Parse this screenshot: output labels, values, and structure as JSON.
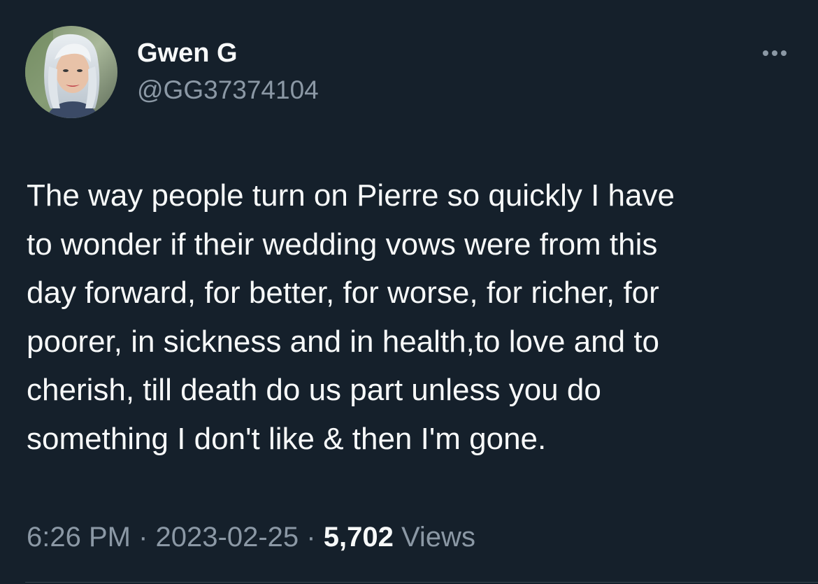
{
  "author": {
    "display_name": "Gwen G",
    "handle": "@GG37374104",
    "avatar_icon": "profile-photo"
  },
  "more_icon": "more-horizontal-icon",
  "tweet": {
    "text": "The way people turn on Pierre so quickly I have\nto wonder if their wedding vows were from this\nday forward, for better, for worse, for richer, for\npoorer, in sickness and in health,to love and to\ncherish, till death do us part unless you do\nsomething I don't like & then I'm gone.",
    "time": "6:26 PM",
    "date": "2023-02-25",
    "views_count": "5,702",
    "views_label": "Views",
    "separator": "·"
  },
  "colors": {
    "background": "#15202b",
    "primary_text": "#f7f9f9",
    "secondary_text": "#8b98a5",
    "divider": "#38444d"
  }
}
